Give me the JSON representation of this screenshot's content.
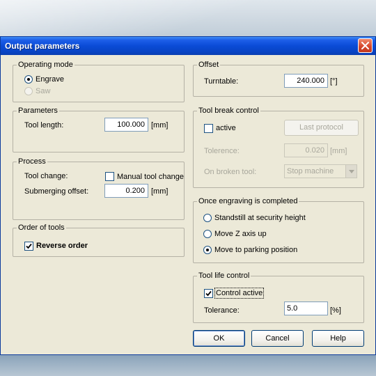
{
  "window": {
    "title": "Output parameters"
  },
  "operating_mode": {
    "title": "Operating mode",
    "engrave": "Engrave",
    "saw": "Saw"
  },
  "parameters": {
    "title": "Parameters",
    "tool_length_label": "Tool length:",
    "tool_length_value": "100.000",
    "tool_length_unit": "[mm]"
  },
  "process": {
    "title": "Process",
    "tool_change_label": "Tool change:",
    "manual_tool_change": "Manual tool change",
    "submerging_offset_label": "Submerging offset:",
    "submerging_offset_value": "0.200",
    "submerging_offset_unit": "[mm]"
  },
  "order_of_tools": {
    "title": "Order of tools",
    "reverse_order": "Reverse order",
    "reverse_order_checked": true
  },
  "offset": {
    "title": "Offset",
    "turntable_label": "Turntable:",
    "turntable_value": "240.000",
    "turntable_unit": "[°]"
  },
  "tool_break_control": {
    "title": "Tool break control",
    "active": "active",
    "last_protocol": "Last protocol",
    "tolerence_label": "Tolerence:",
    "tolerence_value": "0.020",
    "tolerence_unit": "[mm]",
    "on_broken_tool_label": "On broken tool:",
    "on_broken_tool_value": "Stop machine"
  },
  "once_engraving_completed": {
    "title": "Once engraving is completed",
    "options": [
      "Standstill at security height",
      "Move Z axis up",
      "Move to parking position"
    ],
    "selected": "Move to parking position"
  },
  "tool_life_control": {
    "title": "Tool life control",
    "control_active": "Control active",
    "control_active_checked": true,
    "tolerance_label": "Tolerance:",
    "tolerance_value": "5.0",
    "tolerance_unit": "[%]"
  },
  "buttons": {
    "ok": "OK",
    "cancel": "Cancel",
    "help": "Help"
  }
}
